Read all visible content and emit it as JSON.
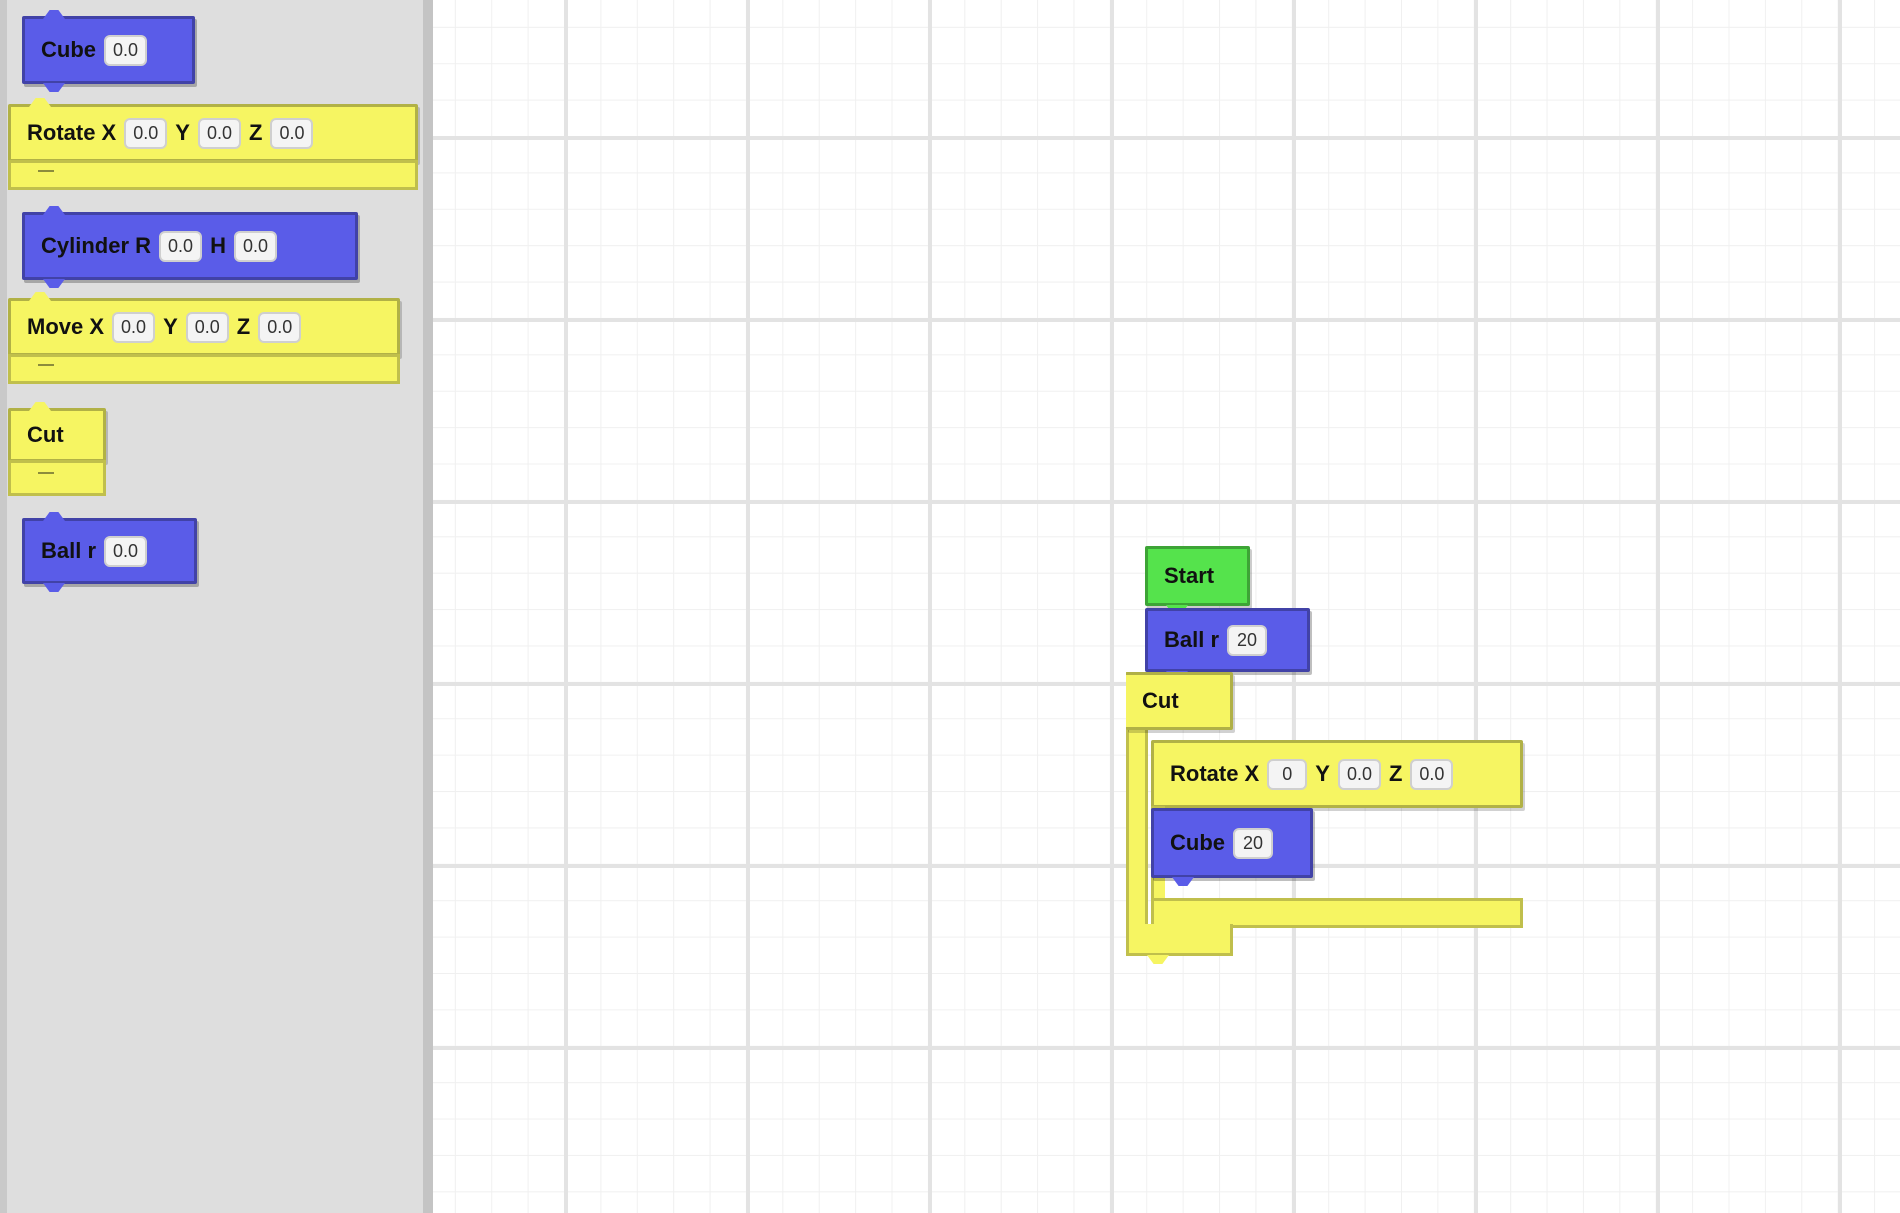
{
  "palette": {
    "cube": {
      "label": "Cube",
      "value": "0.0"
    },
    "rotate": {
      "label": "Rotate X",
      "x": "0.0",
      "y_label": "Y",
      "y": "0.0",
      "z_label": "Z",
      "z": "0.0"
    },
    "cylinder": {
      "label": "Cylinder R",
      "r": "0.0",
      "h_label": "H",
      "h": "0.0"
    },
    "move": {
      "label": "Move X",
      "x": "0.0",
      "y_label": "Y",
      "y": "0.0",
      "z_label": "Z",
      "z": "0.0"
    },
    "cut": {
      "label": "Cut"
    },
    "ball": {
      "label": "Ball r",
      "value": "0.0"
    }
  },
  "workspace": {
    "start": {
      "label": "Start"
    },
    "ball": {
      "label": "Ball r",
      "value": "20"
    },
    "cut": {
      "label": "Cut"
    },
    "rotate": {
      "label": "Rotate X",
      "x": "0",
      "y_label": "Y",
      "y": "0.0",
      "z_label": "Z",
      "z": "0.0"
    },
    "cube": {
      "label": "Cube",
      "value": "20"
    }
  },
  "colors": {
    "shape_block": "#5a5ce8",
    "transform_block": "#f6f562",
    "start_block": "#55e34c",
    "palette_bg": "#dedede"
  }
}
